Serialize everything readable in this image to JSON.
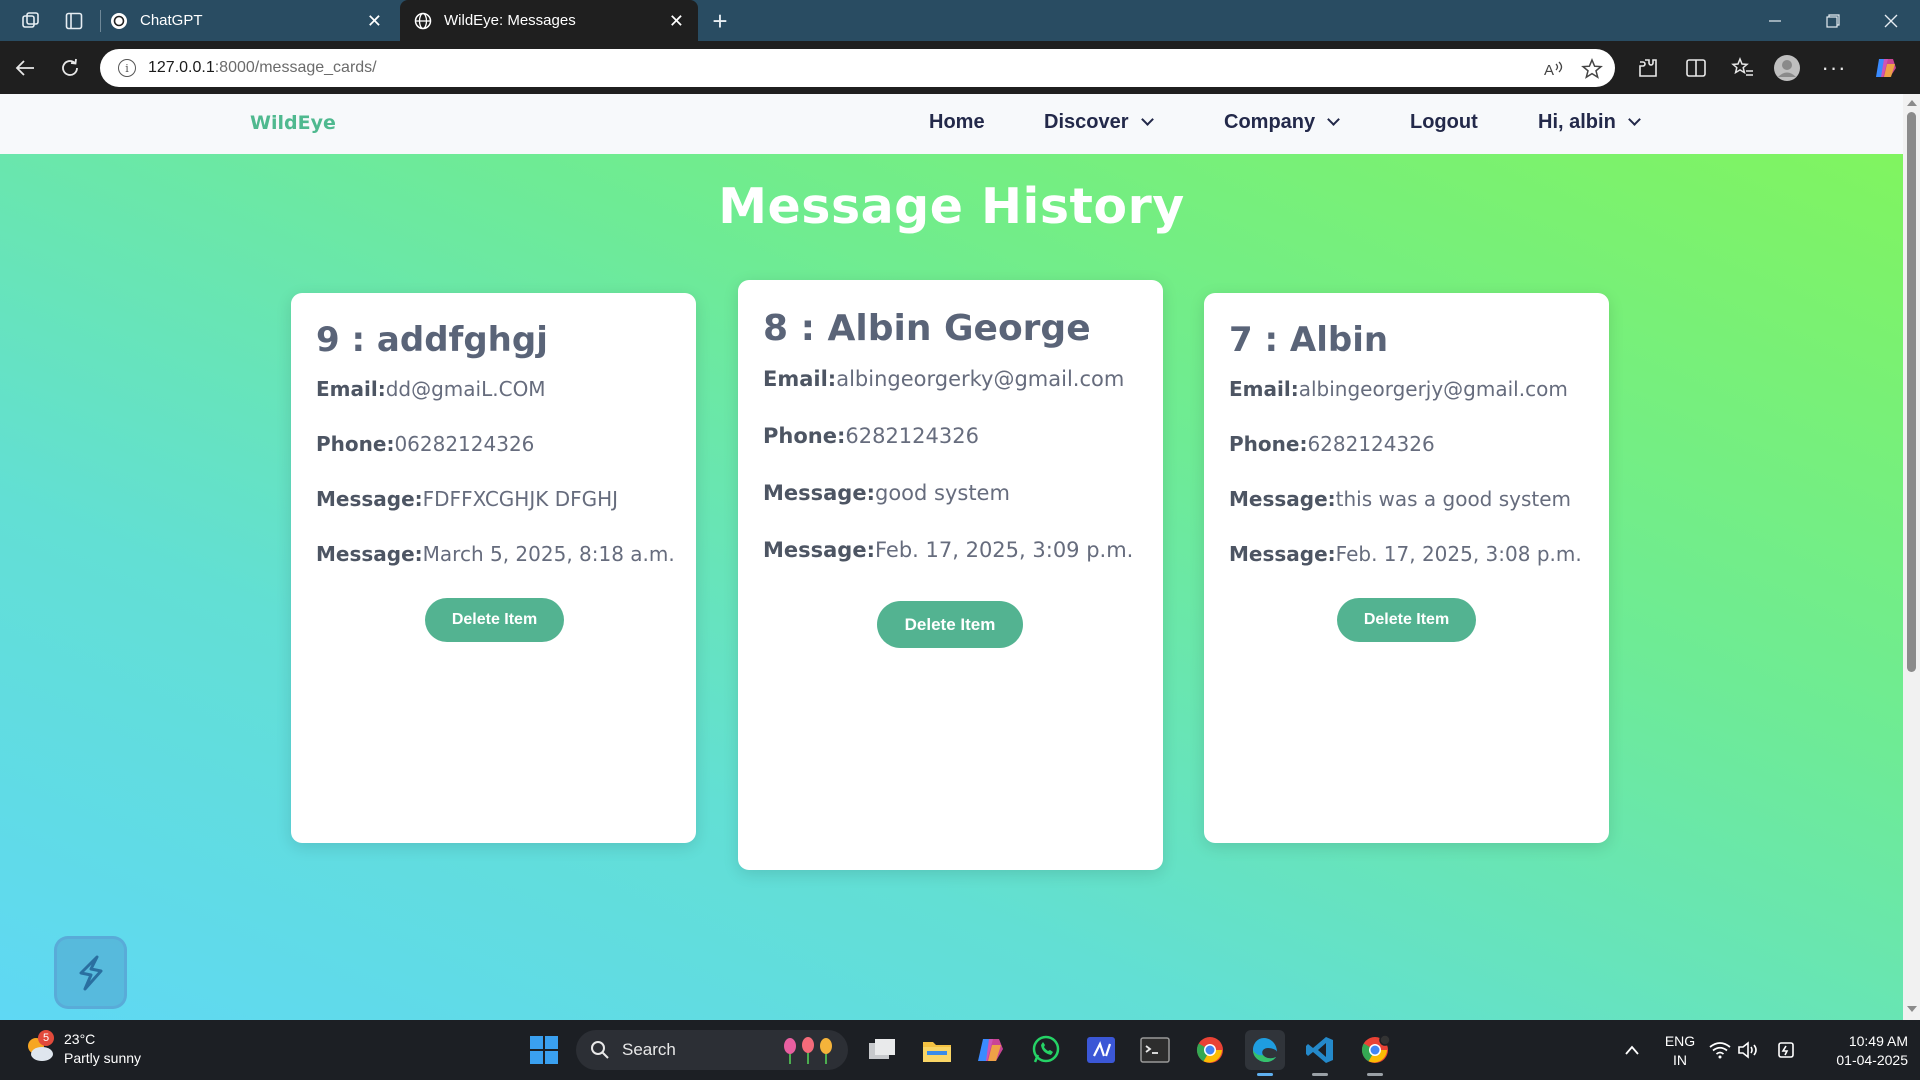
{
  "browser": {
    "tabs": [
      {
        "title": "ChatGPT",
        "active": false
      },
      {
        "title": "WildEye: Messages",
        "active": true
      }
    ],
    "url_host": "127.0.0.1",
    "url_path": ":8000/message_cards/"
  },
  "site": {
    "brand": "WildEye",
    "nav": {
      "home": "Home",
      "discover": "Discover",
      "company": "Company",
      "logout": "Logout",
      "user": "Hi, albin"
    },
    "page_title": "Message History",
    "labels": {
      "email": "Email:",
      "phone": "Phone:",
      "message": "Message:",
      "date": "Message:"
    },
    "delete_label": "Delete Item",
    "cards": [
      {
        "heading": "9 : addfghgj",
        "email": "dd@gmaiL.COM",
        "phone": "06282124326",
        "message": "FDFFXCGHJK DFGHJ",
        "date": "March 5, 2025, 8:18 a.m."
      },
      {
        "heading": "8 : Albin George",
        "email": "albingeorgerky@gmail.com",
        "phone": "6282124326",
        "message": "good system",
        "date": "Feb. 17, 2025, 3:09 p.m."
      },
      {
        "heading": "7 : Albin",
        "email": "albingeorgerjy@gmail.com",
        "phone": "6282124326",
        "message": "this was a good system",
        "date": "Feb. 17, 2025, 3:08 p.m."
      }
    ]
  },
  "taskbar": {
    "weather_temp": "23°C",
    "weather_desc": "Partly sunny",
    "weather_badge": "5",
    "search_label": "Search",
    "lang_top": "ENG",
    "lang_bottom": "IN",
    "time": "10:49 AM",
    "date": "01-04-2025"
  },
  "colors": {
    "accent": "#53b391",
    "brand": "#4fb98f",
    "nav_text": "#23294a"
  }
}
